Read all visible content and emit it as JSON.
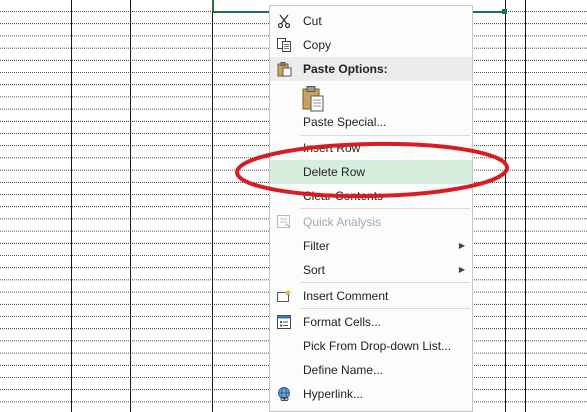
{
  "context_menu": {
    "cut": "Cut",
    "copy": "Copy",
    "paste_options_header": "Paste Options:",
    "paste_special": "Paste Special...",
    "insert_row": "Insert Row",
    "delete_row": "Delete Row",
    "clear_contents": "Clear Contents",
    "quick_analysis": "Quick Analysis",
    "filter": "Filter",
    "sort": "Sort",
    "insert_comment": "Insert Comment",
    "format_cells": "Format Cells...",
    "pick_from_list": "Pick From Drop-down List...",
    "define_name": "Define Name...",
    "hyperlink": "Hyperlink..."
  },
  "icons": {
    "cut": "scissors-icon",
    "copy": "copy-icon",
    "paste": "clipboard-icon",
    "quick_analysis": "quick-analysis-icon",
    "insert_comment": "comment-icon",
    "format_cells": "format-cells-icon",
    "hyperlink": "hyperlink-icon",
    "submenu": "chevron-right-icon"
  },
  "colors": {
    "highlight": "#d6eedd",
    "selected_cell_border": "#217346",
    "annotation_ellipse": "#d81c24"
  }
}
